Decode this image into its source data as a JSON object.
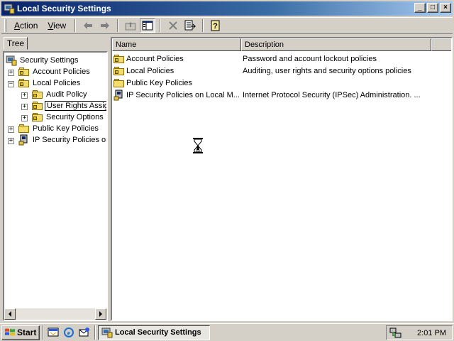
{
  "window": {
    "title": "Local Security Settings",
    "controls": {
      "minimize": "_",
      "maximize": "□",
      "close": "×"
    }
  },
  "menu": {
    "action": {
      "accel": "A",
      "rest": "ction"
    },
    "view": {
      "accel": "V",
      "rest": "iew"
    }
  },
  "tree_tab": "Tree",
  "tree": [
    {
      "label": "Security Settings",
      "icon": "security-settings-icon"
    },
    {
      "label": "Account Policies",
      "icon": "locked-folder-icon",
      "expander": "+"
    },
    {
      "label": "Local Policies",
      "icon": "locked-folder-icon",
      "expander": "−"
    },
    {
      "label": "Audit Policy",
      "icon": "locked-folder-icon",
      "expander": "+"
    },
    {
      "label": "User Rights Assignment",
      "icon": "locked-folder-icon",
      "expander": "+"
    },
    {
      "label": "Security Options",
      "icon": "locked-folder-icon",
      "expander": "+"
    },
    {
      "label": "Public Key Policies",
      "icon": "folder-icon",
      "expander": "+"
    },
    {
      "label": "IP Security Policies on",
      "icon": "ip-security-icon",
      "expander": "+"
    }
  ],
  "list": {
    "columns": [
      "Name",
      "Description"
    ],
    "rows": [
      {
        "name": "Account Policies",
        "description": "Password and account lockout policies",
        "icon": "locked-folder-icon"
      },
      {
        "name": "Local Policies",
        "description": "Auditing, user rights and security options policies",
        "icon": "locked-folder-icon"
      },
      {
        "name": "Public Key Policies",
        "description": "",
        "icon": "folder-icon"
      },
      {
        "name": "IP Security Policies on Local M...",
        "description": "Internet Protocol Security (IPSec) Administration. ...",
        "icon": "ip-security-icon"
      }
    ]
  },
  "taskbar": {
    "start": "Start",
    "task": "Local Security Settings",
    "clock": "2:01 PM"
  },
  "colors": {
    "titlebar_start": "#0a246a",
    "titlebar_end": "#a6caf0",
    "face": "#d4d0c8"
  }
}
